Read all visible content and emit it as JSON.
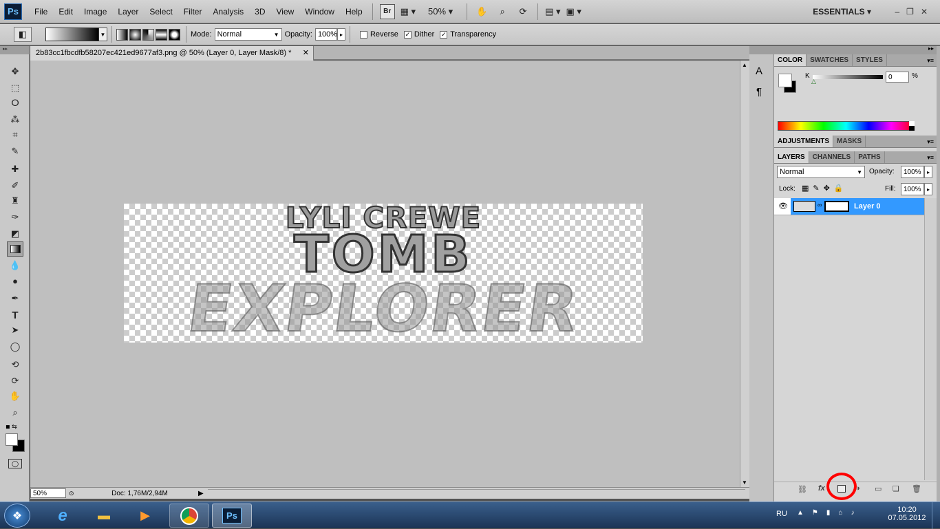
{
  "menubar": {
    "logo": "Ps",
    "items": [
      "File",
      "Edit",
      "Image",
      "Layer",
      "Select",
      "Filter",
      "Analysis",
      "3D",
      "View",
      "Window",
      "Help"
    ],
    "br": "Br",
    "zoom": "50%",
    "workspace": "ESSENTIALS"
  },
  "options": {
    "mode_label": "Mode:",
    "mode_value": "Normal",
    "opacity_label": "Opacity:",
    "opacity_value": "100%",
    "reverse": "Reverse",
    "dither": "Dither",
    "transparency": "Transparency",
    "dither_checked": true,
    "transparency_checked": true,
    "reverse_checked": false
  },
  "document": {
    "tab_title": "2b83cc1fbcdfb58207ec421ed9677af3.png @ 50% (Layer 0, Layer Mask/8) *",
    "zoom": "50%",
    "doc_size": "Doc: 1,76M/2,94M",
    "art": {
      "line1": "LYLI CREWE",
      "line2": "TOMB",
      "line3": "EXPLORER"
    }
  },
  "color_panel": {
    "tabs": [
      "COLOR",
      "SWATCHES",
      "STYLES"
    ],
    "channel": "K",
    "value": "0",
    "unit": "%"
  },
  "adjust_panel": {
    "tabs": [
      "ADJUSTMENTS",
      "MASKS"
    ]
  },
  "layers_panel": {
    "tabs": [
      "LAYERS",
      "CHANNELS",
      "PATHS"
    ],
    "blend": "Normal",
    "opacity_label": "Opacity:",
    "opacity": "100%",
    "lock_label": "Lock:",
    "fill_label": "Fill:",
    "fill": "100%",
    "layers": [
      {
        "name": "Layer 0"
      }
    ]
  },
  "taskbar": {
    "lang": "RU",
    "time": "10:20",
    "date": "07.05.2012",
    "ps_label": "Ps"
  },
  "colors": {
    "accent": "#3399ff",
    "highlight_circle": "#ff0000"
  }
}
